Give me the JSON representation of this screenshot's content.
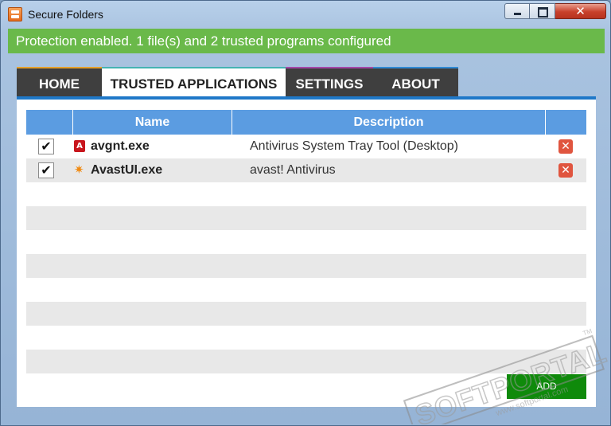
{
  "window": {
    "title": "Secure Folders"
  },
  "window_controls": {
    "minimize": "minimize",
    "maximize": "maximize",
    "close": "close",
    "close_glyph": "✕"
  },
  "status": {
    "text": "Protection enabled. 1 file(s) and 2 trusted programs configured",
    "color": "#6ab94a"
  },
  "tabs": [
    {
      "label": "HOME",
      "accent": "#e6a02a",
      "active": false
    },
    {
      "label": "TRUSTED APPLICATIONS",
      "accent": "#44b3b2",
      "active": true
    },
    {
      "label": "SETTINGS",
      "accent": "#a548a8",
      "active": false
    },
    {
      "label": "ABOUT",
      "accent": "#2f8ad5",
      "active": false
    }
  ],
  "table": {
    "columns": [
      "",
      "Name",
      "Description",
      ""
    ],
    "rows": [
      {
        "checked": true,
        "check_glyph": "✔",
        "icon": "avira-icon",
        "icon_glyph": "A",
        "name": "avgnt.exe",
        "description": "Antivirus System Tray Tool (Desktop)",
        "delete_glyph": "✕"
      },
      {
        "checked": true,
        "check_glyph": "✔",
        "icon": "avast-icon",
        "icon_glyph": "✷",
        "name": "AvastUI.exe",
        "description": "avast! Antivirus",
        "delete_glyph": "✕"
      }
    ],
    "empty_rows": 9
  },
  "add_button": {
    "label": "ADD",
    "color": "#0f8a0b"
  },
  "watermark": {
    "brand": "SOFTPORTAL",
    "url": "www.softportal.com",
    "tm": "TM"
  }
}
